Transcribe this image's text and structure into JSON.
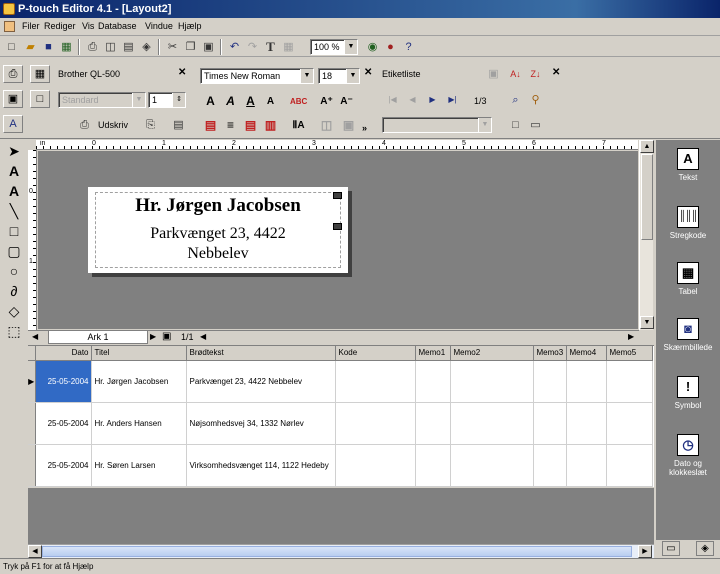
{
  "window": {
    "title": "P-touch Editor 4.1 - [Layout2]"
  },
  "menu": {
    "items": [
      "Filer",
      "Rediger",
      "Vis",
      "Database",
      "Vindue",
      "Hjælp"
    ]
  },
  "toolbar": {
    "zoom": "100 %",
    "text_tool_glyph": "T"
  },
  "printer_panel": {
    "printer": "Brother QL-500",
    "paper": "Standard",
    "copies": "1",
    "print_label": "Udskriv"
  },
  "font_panel": {
    "font": "Times New Roman",
    "size": "18"
  },
  "label_panel": {
    "category": "Etiketliste",
    "page_indicator": "1/3"
  },
  "canvas": {
    "label": {
      "line1": "Hr. Jørgen Jacobsen",
      "line2": "Parkvænget 23, 4422",
      "line3": "Nebbelev"
    }
  },
  "ruler_labels": [
    "0",
    "1",
    "2",
    "3",
    "4",
    "5",
    "6",
    "7"
  ],
  "sheet": {
    "tab": "Ark 1",
    "page": "1/1"
  },
  "database": {
    "columns": [
      "Dato",
      "Titel",
      "Brødtekst",
      "Kode",
      "Memo1",
      "Memo2",
      "Memo3",
      "Memo4",
      "Memo5"
    ],
    "rows": [
      [
        "25-05-2004",
        "Hr. Jørgen Jacobsen",
        "Parkvænget 23, 4422 Nebbelev",
        "",
        "",
        "",
        "",
        "",
        ""
      ],
      [
        "25-05-2004",
        "Hr. Anders Hansen",
        "Nøjsomhedsvej 34, 1332 Nørlev",
        "",
        "",
        "",
        "",
        "",
        ""
      ],
      [
        "25-05-2004",
        "Hr. Søren Larsen",
        "Virksomhedsvænget 114, 1122 Hedeby",
        "",
        "",
        "",
        "",
        "",
        ""
      ]
    ],
    "selected_row": 0
  },
  "right_panel": {
    "items": [
      {
        "label": "Tekst",
        "icon": "text-icon"
      },
      {
        "label": "Stregkode",
        "icon": "barcode-icon"
      },
      {
        "label": "Tabel",
        "icon": "table-icon"
      },
      {
        "label": "Skærmbillede",
        "icon": "screenshot-icon"
      },
      {
        "label": "Symbol",
        "icon": "symbol-icon"
      },
      {
        "label": "Dato og klokkeslæt",
        "icon": "clock-icon"
      }
    ]
  },
  "status": {
    "text": "Tryk på F1 for at få Hjælp"
  },
  "colors": {
    "title_bar": "#0a246a",
    "selection": "#316ac5",
    "canvas_bg": "#808080"
  }
}
